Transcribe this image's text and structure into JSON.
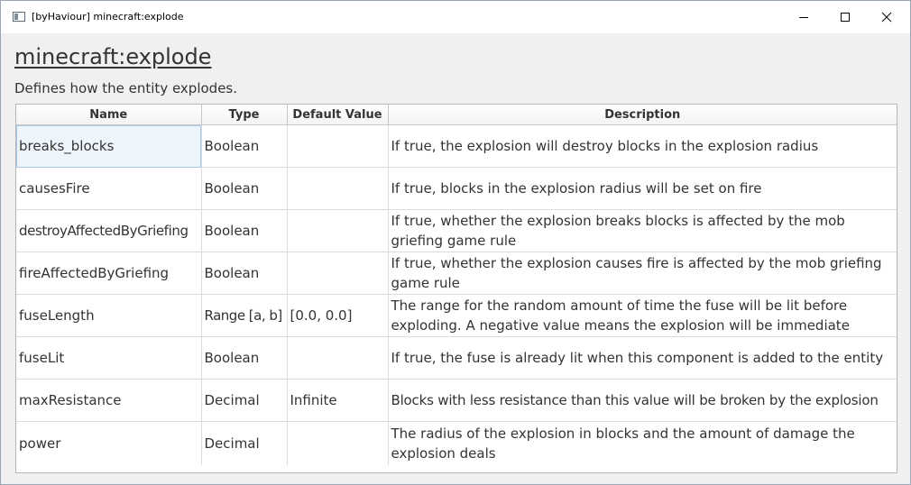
{
  "window": {
    "title": "[byHaviour] minecraft:explode"
  },
  "page": {
    "title": "minecraft:explode",
    "description": "Defines how the entity explodes."
  },
  "table": {
    "columns": [
      "Name",
      "Type",
      "Default Value",
      "Description"
    ],
    "rows": [
      {
        "name": "breaks_blocks",
        "type": "Boolean",
        "default": "",
        "description": "If true, the explosion will destroy blocks in the explosion radius"
      },
      {
        "name": "causesFire",
        "type": "Boolean",
        "default": "",
        "description": "If true, blocks in the explosion radius will be set on fire"
      },
      {
        "name": "destroyAffectedByGriefing",
        "type": "Boolean",
        "default": "",
        "description": "If true, whether the explosion breaks blocks is affected by the mob griefing game rule"
      },
      {
        "name": "fireAffectedByGriefing",
        "type": "Boolean",
        "default": "",
        "description": "If true, whether the explosion causes fire is affected by the mob griefing game rule"
      },
      {
        "name": "fuseLength",
        "type": "Range [a, b]",
        "default": "[0.0, 0.0]",
        "description": "The range for the random amount of time the fuse will be lit before exploding. A negative value means the explosion will be immediate"
      },
      {
        "name": "fuseLit",
        "type": "Boolean",
        "default": "",
        "description": "If true, the fuse is already lit when this component is added to the entity"
      },
      {
        "name": "maxResistance",
        "type": "Decimal",
        "default": "Infinite",
        "description": "Blocks with less resistance than this value will be broken by the explosion"
      },
      {
        "name": "power",
        "type": "Decimal",
        "default": "",
        "description": "The radius of the explosion in blocks and the amount of damage the explosion deals"
      }
    ]
  },
  "icons": {
    "app": "window-app-icon",
    "minimize": "minimize-icon",
    "maximize": "maximize-icon",
    "close": "close-icon"
  }
}
